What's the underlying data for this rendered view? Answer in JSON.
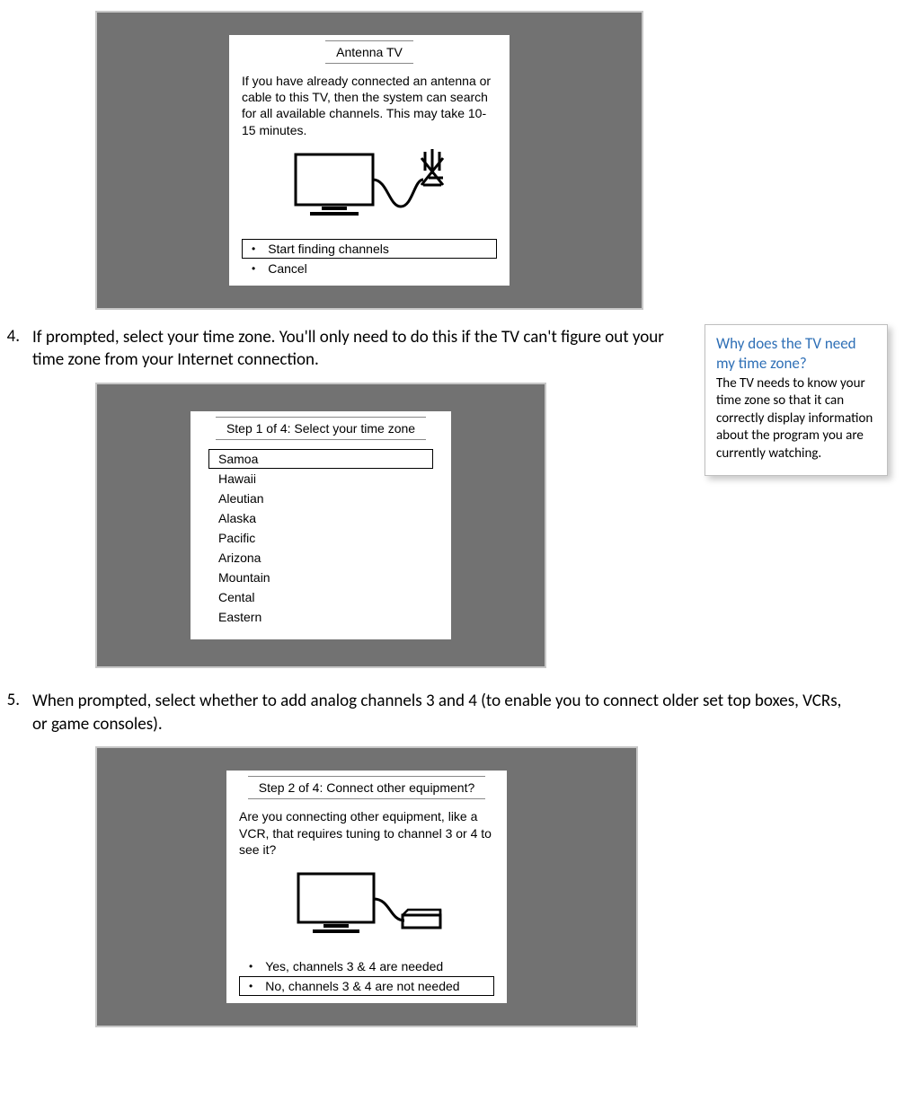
{
  "screen1": {
    "title": "Antenna TV",
    "body": "If you have already connected an antenna or cable to this TV, then the system can search for all available channels. This may take 10-15 minutes.",
    "options": [
      {
        "label": "Start finding channels",
        "selected": true
      },
      {
        "label": "Cancel",
        "selected": false
      }
    ]
  },
  "step4": {
    "number": "4.",
    "text": "If prompted, select your time zone. You'll only need to do this if the TV can't figure out your time zone from your Internet connection."
  },
  "sidebar": {
    "title": "Why does the TV need my time zone?",
    "body": "The TV needs to know your time zone so that it can correctly display information about the program you are currently watching."
  },
  "screen2": {
    "title": "Step 1 of 4: Select your time zone",
    "items": [
      {
        "label": "Samoa",
        "selected": true
      },
      {
        "label": "Hawaii",
        "selected": false
      },
      {
        "label": "Aleutian",
        "selected": false
      },
      {
        "label": "Alaska",
        "selected": false
      },
      {
        "label": "Pacific",
        "selected": false
      },
      {
        "label": "Arizona",
        "selected": false
      },
      {
        "label": "Mountain",
        "selected": false
      },
      {
        "label": "Cental",
        "selected": false
      },
      {
        "label": "Eastern",
        "selected": false
      }
    ]
  },
  "step5": {
    "number": "5.",
    "text": "When prompted, select whether to add analog channels 3 and 4 (to enable you to connect older set top boxes, VCRs, or game consoles)."
  },
  "screen3": {
    "title": "Step 2 of 4: Connect other equipment?",
    "body": "Are you connecting other equipment, like a VCR, that requires tuning to channel 3 or 4 to see it?",
    "options": [
      {
        "label": "Yes, channels 3 & 4 are needed",
        "selected": false
      },
      {
        "label": "No, channels 3 & 4 are not needed",
        "selected": true
      }
    ]
  }
}
